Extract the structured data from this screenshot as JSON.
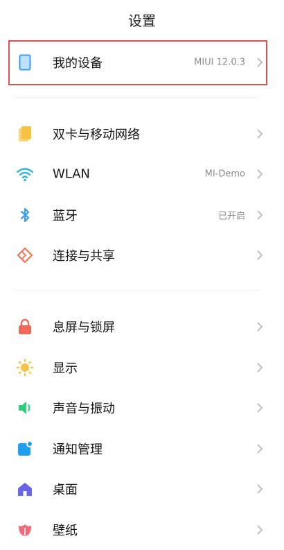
{
  "header": {
    "title": "设置"
  },
  "my_device": {
    "label": "我的设备",
    "value": "MIUI 12.0.3",
    "icon": "device-icon"
  },
  "group1": [
    {
      "key": "dual-sim",
      "label": "双卡与移动网络",
      "value": "",
      "icon": "sim-card-icon",
      "color": "#f6c343"
    },
    {
      "key": "wlan",
      "label": "WLAN",
      "value": "MI-Demo",
      "icon": "wifi-icon",
      "color": "#2fb5d8"
    },
    {
      "key": "bluetooth",
      "label": "蓝牙",
      "value": "已开启",
      "icon": "bluetooth-icon",
      "color": "#3a9bf0"
    },
    {
      "key": "connection-sharing",
      "label": "连接与共享",
      "value": "",
      "icon": "connection-sharing-icon",
      "color": "#f08063"
    }
  ],
  "group2": [
    {
      "key": "lock-screen",
      "label": "息屏与锁屏",
      "value": "",
      "icon": "lock-icon",
      "color": "#f06a5a"
    },
    {
      "key": "display",
      "label": "显示",
      "value": "",
      "icon": "sun-icon",
      "color": "#f6c343"
    },
    {
      "key": "sound",
      "label": "声音与振动",
      "value": "",
      "icon": "speaker-icon",
      "color": "#2ecf7a"
    },
    {
      "key": "notifications",
      "label": "通知管理",
      "value": "",
      "icon": "notification-icon",
      "color": "#1f9ff0"
    },
    {
      "key": "desktop",
      "label": "桌面",
      "value": "",
      "icon": "home-icon",
      "color": "#6b65e8"
    },
    {
      "key": "wallpaper",
      "label": "壁纸",
      "value": "",
      "icon": "flower-icon",
      "color": "#f06a7a"
    }
  ]
}
